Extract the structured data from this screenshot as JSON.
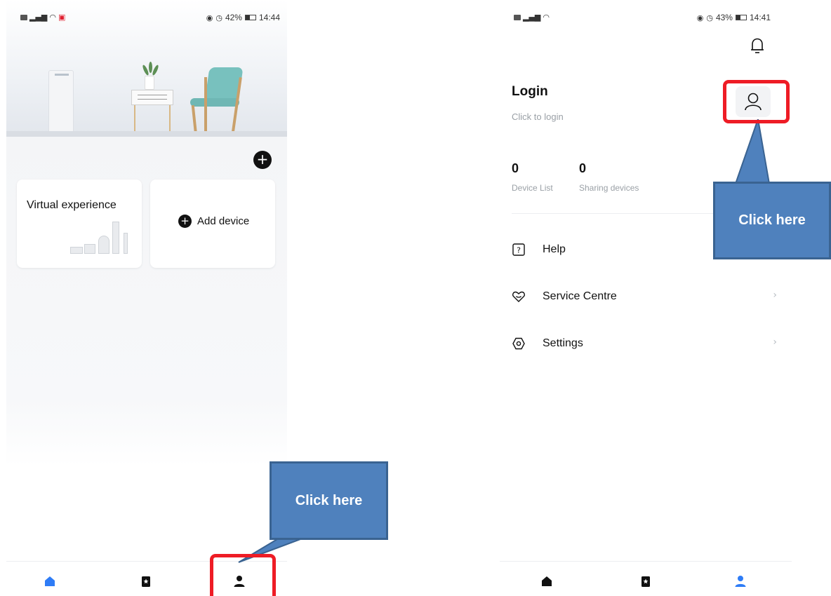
{
  "left_screen": {
    "status": {
      "time": "14:44",
      "battery": "42%"
    },
    "add_button_symbol": "+",
    "cards": {
      "virtual_experience": "Virtual experience",
      "add_device": "Add device",
      "add_device_symbol": "+"
    },
    "tabs": [
      {
        "icon": "home-icon",
        "active": true
      },
      {
        "icon": "bookmark-icon",
        "active": false
      },
      {
        "icon": "person-icon",
        "active": false
      }
    ]
  },
  "right_screen": {
    "status": {
      "time": "14:41",
      "battery": "43%"
    },
    "login": {
      "title": "Login",
      "subtitle": "Click to login"
    },
    "stats": [
      {
        "value": "0",
        "label": "Device List"
      },
      {
        "value": "0",
        "label": "Sharing devices"
      }
    ],
    "menu": [
      {
        "label": "Help",
        "icon": "help-icon"
      },
      {
        "label": "Service Centre",
        "icon": "heart-chat-icon",
        "chevron": "›"
      },
      {
        "label": "Settings",
        "icon": "settings-icon",
        "chevron": "›"
      }
    ],
    "tabs": [
      {
        "icon": "home-icon",
        "active": false
      },
      {
        "icon": "bookmark-icon",
        "active": false
      },
      {
        "icon": "person-icon",
        "active": true
      }
    ]
  },
  "annotations": {
    "callout_left": "Click here",
    "callout_right": "Click here",
    "callout_color": "#4f81bd",
    "highlight_color": "#ee1c25"
  },
  "colors": {
    "active_tab": "#2e7cf6",
    "inactive_tab": "#111111"
  }
}
